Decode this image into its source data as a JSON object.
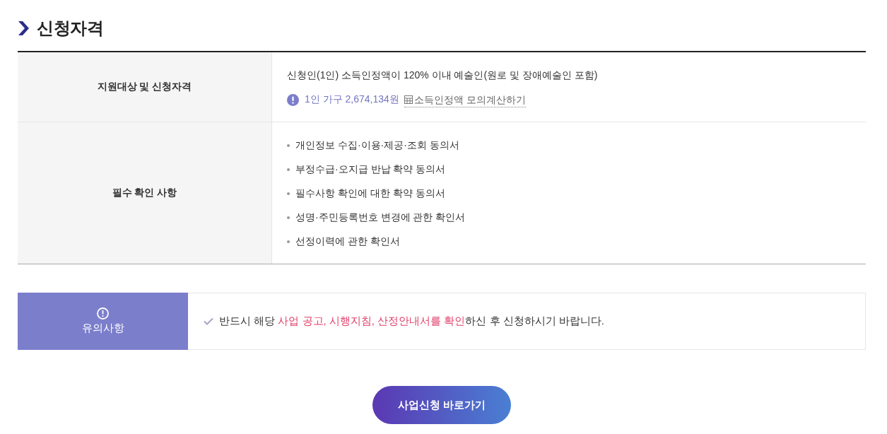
{
  "section": {
    "title": "신청자격"
  },
  "table": {
    "rows": [
      {
        "kind": "eligibility",
        "header": "지원대상 및 신청자격",
        "text": "신청인(1인) 소득인정액이 120% 이내 예술인(원로 및 장애예술인 포함)",
        "note": "1인 가구 2,674,134원",
        "link": "소득인정액 모의계산하기"
      },
      {
        "kind": "list",
        "header": "필수 확인 사항",
        "items": [
          "개인정보 수집·이용·제공·조회 동의서",
          "부정수급·오지급 반납 확약 동의서",
          "필수사항 확인에 대한 확약 동의서",
          "성명·주민등록번호 변경에 관한 확인서",
          "선정이력에 관한 확인서"
        ]
      }
    ]
  },
  "notice": {
    "label": "유의사항",
    "message": [
      {
        "text": "반드시 해당 ",
        "highlight": false
      },
      {
        "text": "사업 공고, 시행지침, 산정안내서를 확인",
        "highlight": true
      },
      {
        "text": "하신 후 신청하시기 바랍니다.",
        "highlight": false
      }
    ]
  },
  "apply_button": {
    "label": "사업신청 바로가기"
  }
}
